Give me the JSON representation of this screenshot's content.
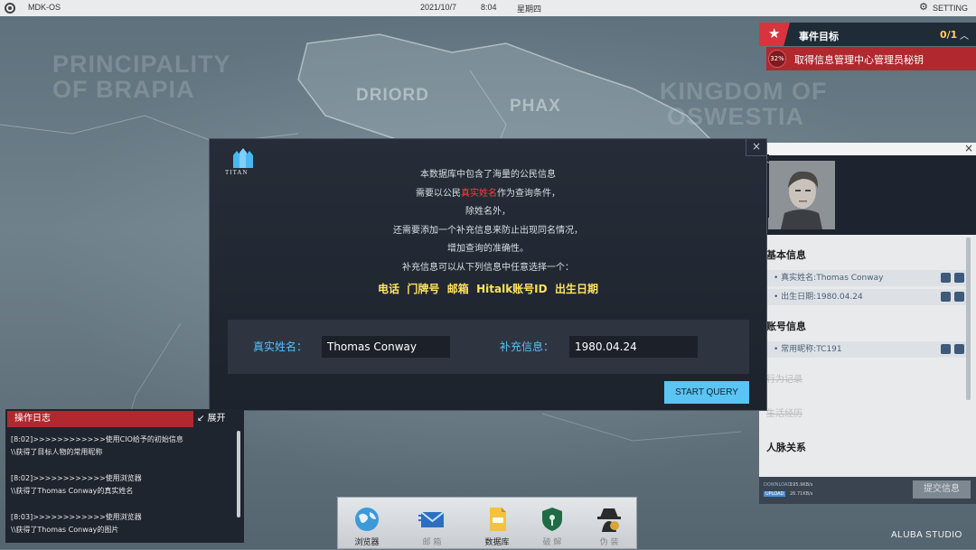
{
  "topbar": {
    "os_name": "MDK-OS",
    "date": "2021/10/7",
    "time": "8:04",
    "weekday": "星期四",
    "setting_label": "SETTING",
    "logo_icon": "eye-logo-icon",
    "gear_icon": "gear-icon"
  },
  "map": {
    "regions": [
      "PRINCIPALITY",
      "OF BRAPIA",
      "DRIORD",
      "PHAX",
      "KINGDOM OF",
      "OSWESTIA"
    ]
  },
  "event_target": {
    "title": "事件目标",
    "progress_count": "0/1",
    "percent": "32%",
    "description": "取得信息管理中心管理员秘钥",
    "star_icon": "star-icon",
    "accent_color": "#b1282f"
  },
  "query_dialog": {
    "logo_text": "TITAN",
    "close_glyph": "×",
    "line1": "本数据库中包含了海量的公民信息",
    "line2_pre": "需要以公民",
    "line2_red": "真实姓名",
    "line2_post": "作为查询条件，",
    "line3": "除姓名外，",
    "line4": "还需要添加一个补充信息来防止出现同名情况，",
    "line5": "增加查询的准确性。",
    "line6": "补充信息可以从下列信息中任意选择一个：",
    "options": "电话  门牌号  邮箱  Hitalk账号ID  出生日期",
    "name_label": "真实姓名：",
    "name_value": "Thomas Conway",
    "extra_label": "补充信息：",
    "extra_value": "1980.04.24",
    "start_button": "START QUERY"
  },
  "profile": {
    "close_glyph": "×",
    "photo_name": "Thomas Conway",
    "basic_title": "基本信息",
    "real_name": "• 真实姓名:Thomas Conway",
    "birthday": "• 出生日期:1980.04.24",
    "account_title": "账号信息",
    "nickname": "• 常用昵称:TC191",
    "behavior_title": "行为记录",
    "life_title": "生活经历",
    "relation_title": "人脉关系",
    "download_label": "DOWNLOAD",
    "download_value": "195.9KB/s",
    "upload_label": "UPLOAD",
    "upload_value": "26.71KB/s",
    "submit_label": "提交信息"
  },
  "log": {
    "title": "操作日志",
    "expand_label": "↙ 展开",
    "entries": [
      [
        "[8:02]>>>>>>>>>>>>使用CIO给予的初始信息",
        "\\\\获得了目标人物的常用昵称"
      ],
      [
        "[8:02]>>>>>>>>>>>>使用浏览器",
        "\\\\获得了Thomas Conway的真实姓名"
      ],
      [
        "[8:03]>>>>>>>>>>>>使用浏览器",
        "\\\\获得了Thomas Conway的图片"
      ]
    ]
  },
  "dock": {
    "apps": [
      {
        "label": "浏览器",
        "icon": "globe-icon"
      },
      {
        "label": "邮 箱",
        "icon": "mail-icon"
      },
      {
        "label": "数据库",
        "icon": "database-icon"
      },
      {
        "label": "破 解",
        "icon": "shield-lock-icon"
      },
      {
        "label": "伪 装",
        "icon": "spy-icon"
      }
    ]
  },
  "studio": "ALUBA STUDIO"
}
